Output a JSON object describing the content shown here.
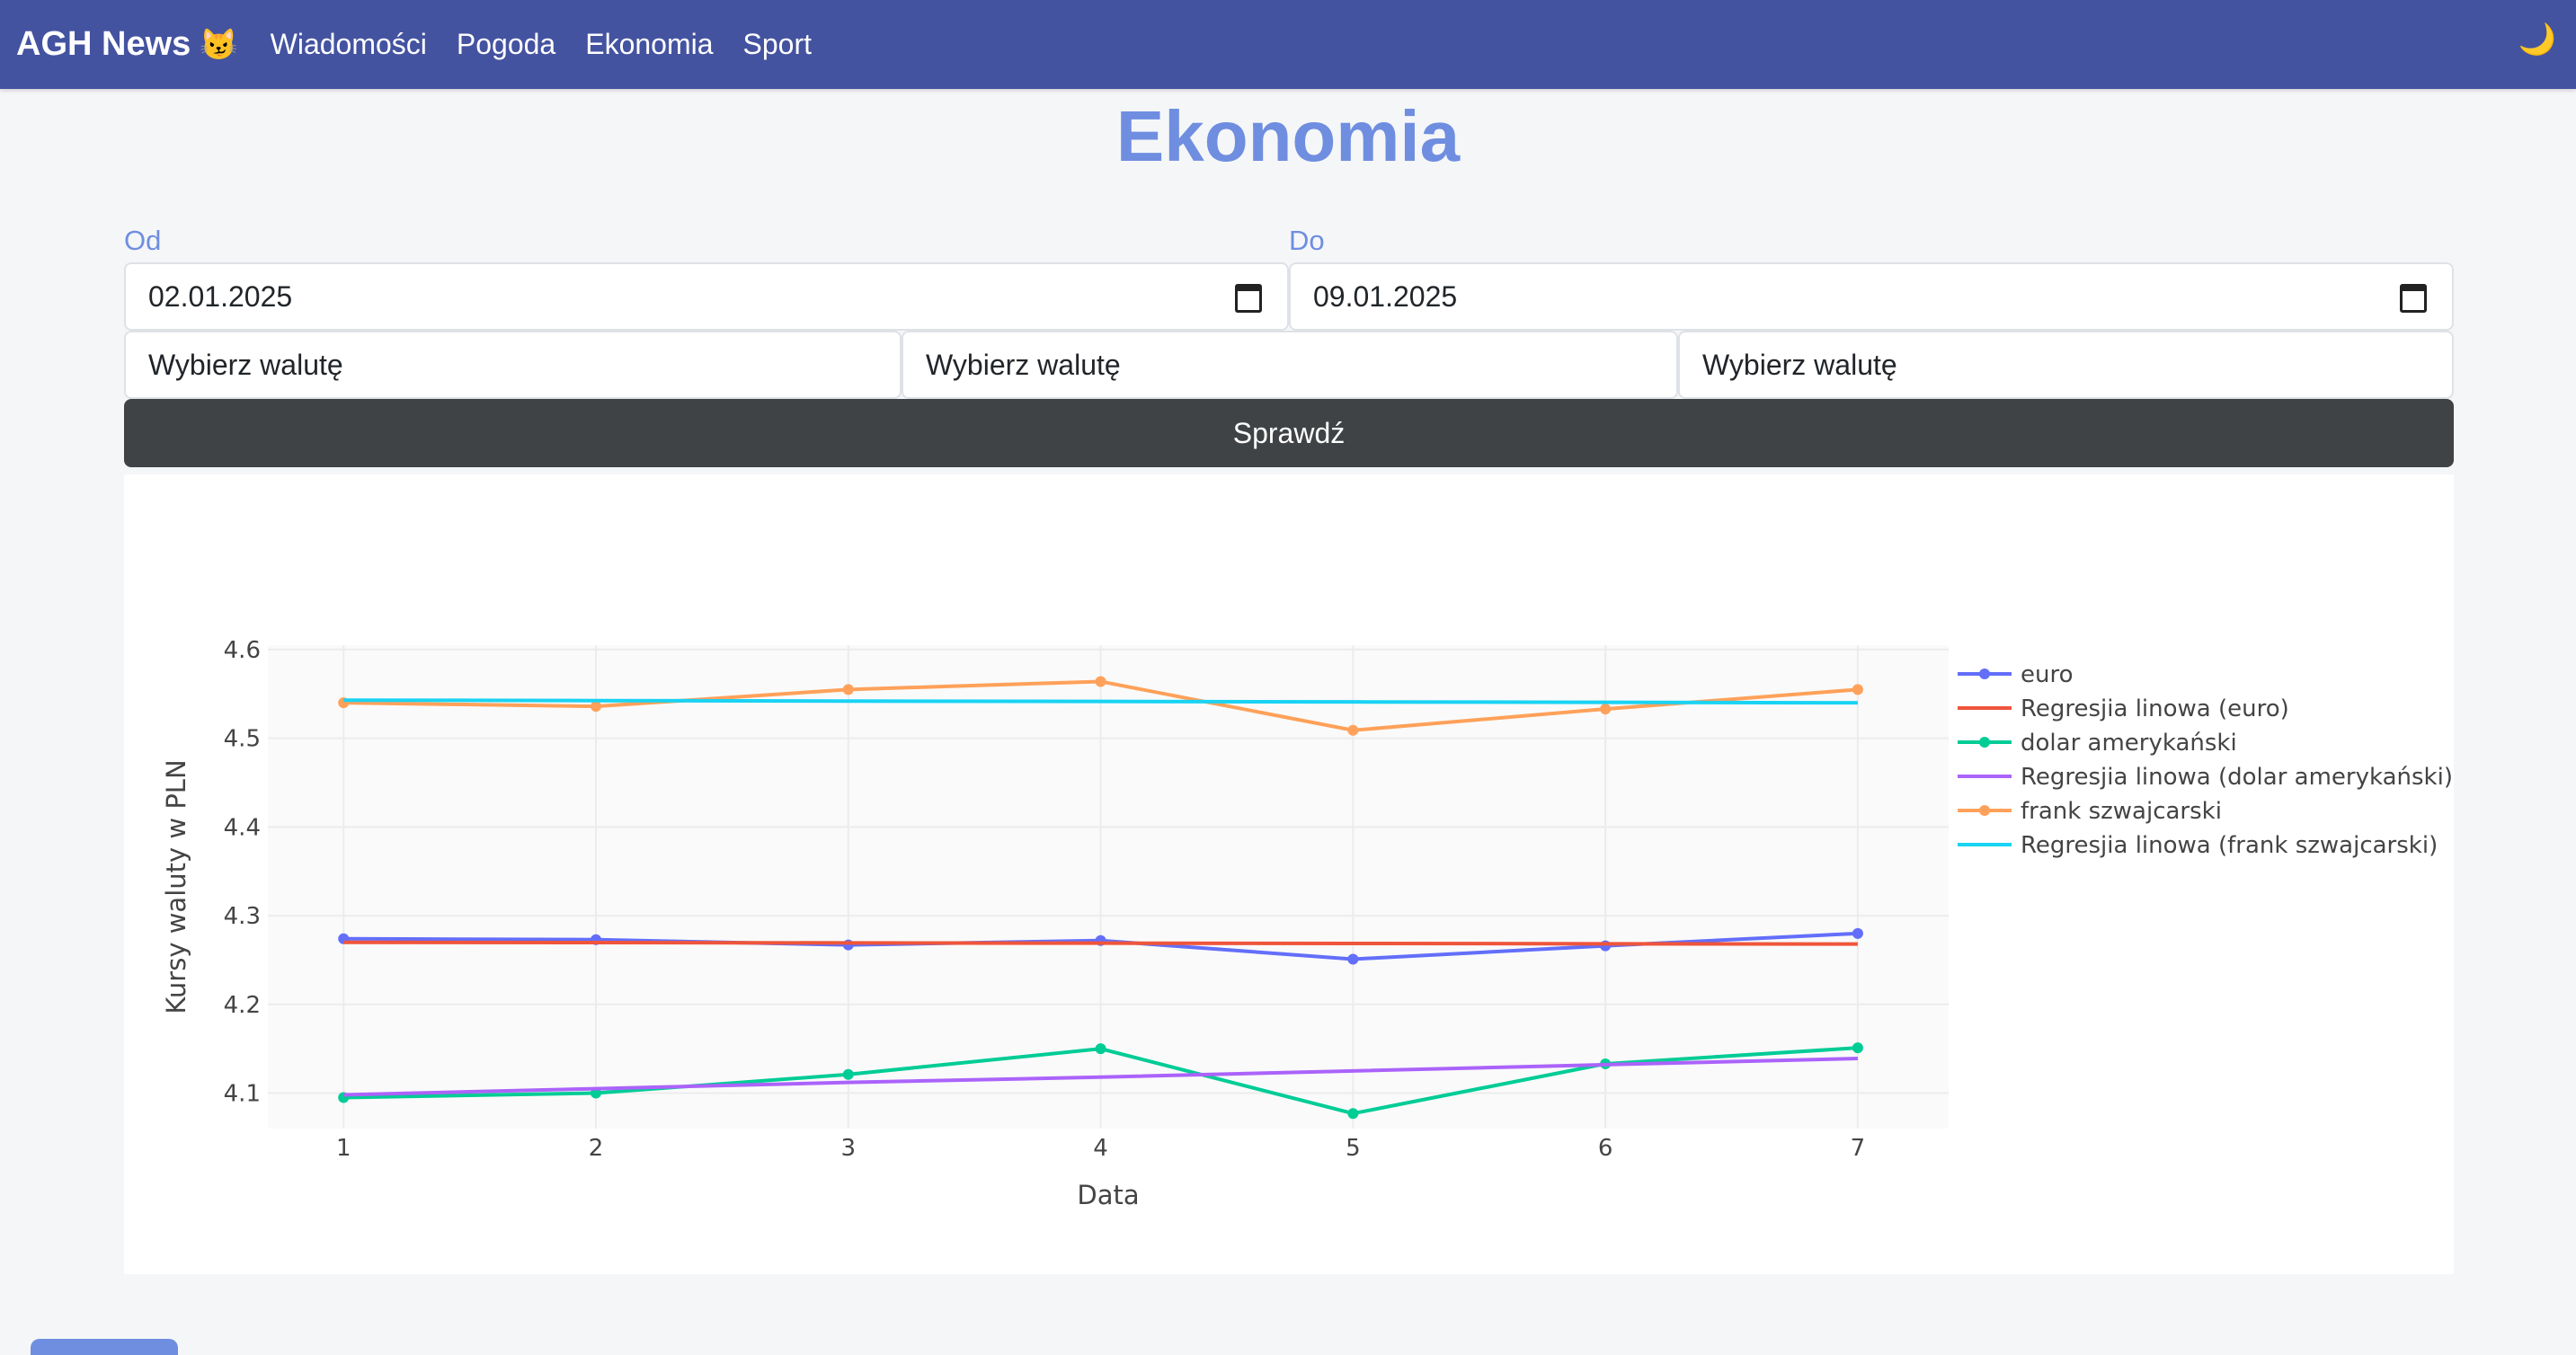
{
  "navbar": {
    "brand": "AGH News",
    "brand_icon": "😼",
    "links": [
      "Wiadomości",
      "Pogoda",
      "Ekonomia",
      "Sport"
    ],
    "theme_icon": "🌙"
  },
  "page": {
    "title": "Ekonomia"
  },
  "form": {
    "from_label": "Od",
    "from_value": "02.01.2025",
    "to_label": "Do",
    "to_value": "09.01.2025",
    "currency_placeholder": "Wybierz walutę",
    "submit_label": "Sprawdź"
  },
  "colors": {
    "navbar": "#4453a0",
    "accent": "#6f8ee0",
    "button": "#404346"
  },
  "chart_data": {
    "type": "line",
    "xlabel": "Data",
    "ylabel": "Kursy waluty w PLN",
    "x": [
      1,
      2,
      3,
      4,
      5,
      6,
      7
    ],
    "xticks": [
      "1",
      "2",
      "3",
      "4",
      "5",
      "6",
      "7"
    ],
    "yticks": [
      "4.1",
      "4.2",
      "4.3",
      "4.4",
      "4.5",
      "4.6"
    ],
    "ylim": [
      4.06,
      4.605
    ],
    "xlim": [
      0.7,
      7.36
    ],
    "legend_position": "top-right",
    "series": [
      {
        "name": "euro",
        "color": "#636efa",
        "markers": true,
        "values": [
          4.274,
          4.273,
          4.267,
          4.272,
          4.251,
          4.266,
          4.28
        ]
      },
      {
        "name": "Regresjia linowa (euro)",
        "color": "#ef553b",
        "markers": false,
        "values": [
          4.27,
          4.2697,
          4.2693,
          4.269,
          4.2687,
          4.2683,
          4.268
        ]
      },
      {
        "name": "dolar amerykański",
        "color": "#00cc96",
        "markers": true,
        "values": [
          4.095,
          4.1,
          4.121,
          4.15,
          4.077,
          4.133,
          4.151
        ]
      },
      {
        "name": "Regresjia linowa (dolar amerykański)",
        "color": "#ab63fa",
        "markers": false,
        "values": [
          4.098,
          4.105,
          4.112,
          4.118,
          4.125,
          4.132,
          4.139
        ]
      },
      {
        "name": "frank szwajcarski",
        "color": "#ffa15a",
        "markers": true,
        "values": [
          4.54,
          4.536,
          4.555,
          4.564,
          4.509,
          4.533,
          4.555
        ]
      },
      {
        "name": "Regresjia linowa (frank szwajcarski)",
        "color": "#19d3f3",
        "markers": false,
        "values": [
          4.543,
          4.5425,
          4.542,
          4.5415,
          4.541,
          4.5405,
          4.54
        ]
      }
    ]
  }
}
